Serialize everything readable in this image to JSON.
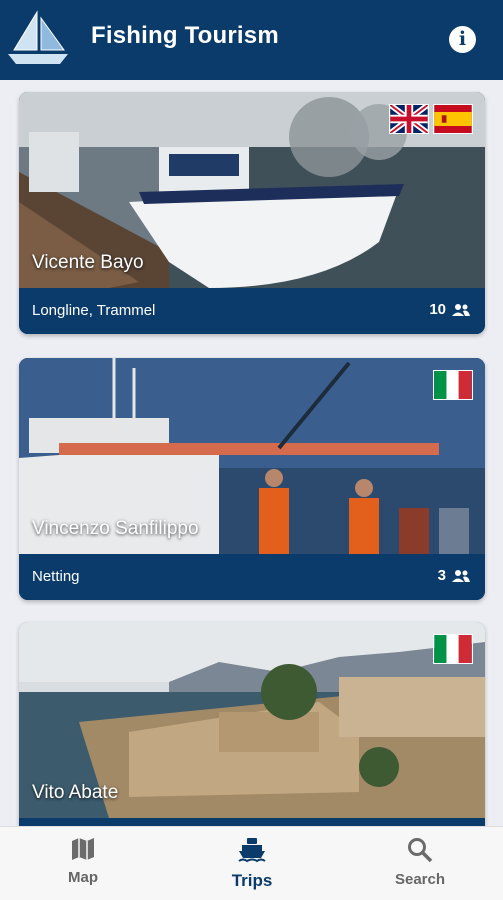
{
  "app": {
    "title": "Fishing Tourism"
  },
  "trips": [
    {
      "name": "Vicente Bayo",
      "gear": "Longline, Trammel",
      "capacity": "10",
      "flags": [
        "uk-flag-icon",
        "spain-flag-icon"
      ]
    },
    {
      "name": "Vincenzo Sanfilippo",
      "gear": "Netting",
      "capacity": "3",
      "flags": [
        "italy-flag-icon"
      ]
    },
    {
      "name": "Vito Abate",
      "gear": "",
      "capacity": "",
      "flags": [
        "italy-flag-icon"
      ]
    }
  ],
  "nav": {
    "items": [
      {
        "label": "Map",
        "icon": "map-icon",
        "active": false
      },
      {
        "label": "Trips",
        "icon": "boat-icon",
        "active": true
      },
      {
        "label": "Search",
        "icon": "search-icon",
        "active": false
      }
    ]
  },
  "colors": {
    "primary": "#0a3b6b",
    "background": "#eceef3",
    "nav_inactive": "#666666"
  }
}
